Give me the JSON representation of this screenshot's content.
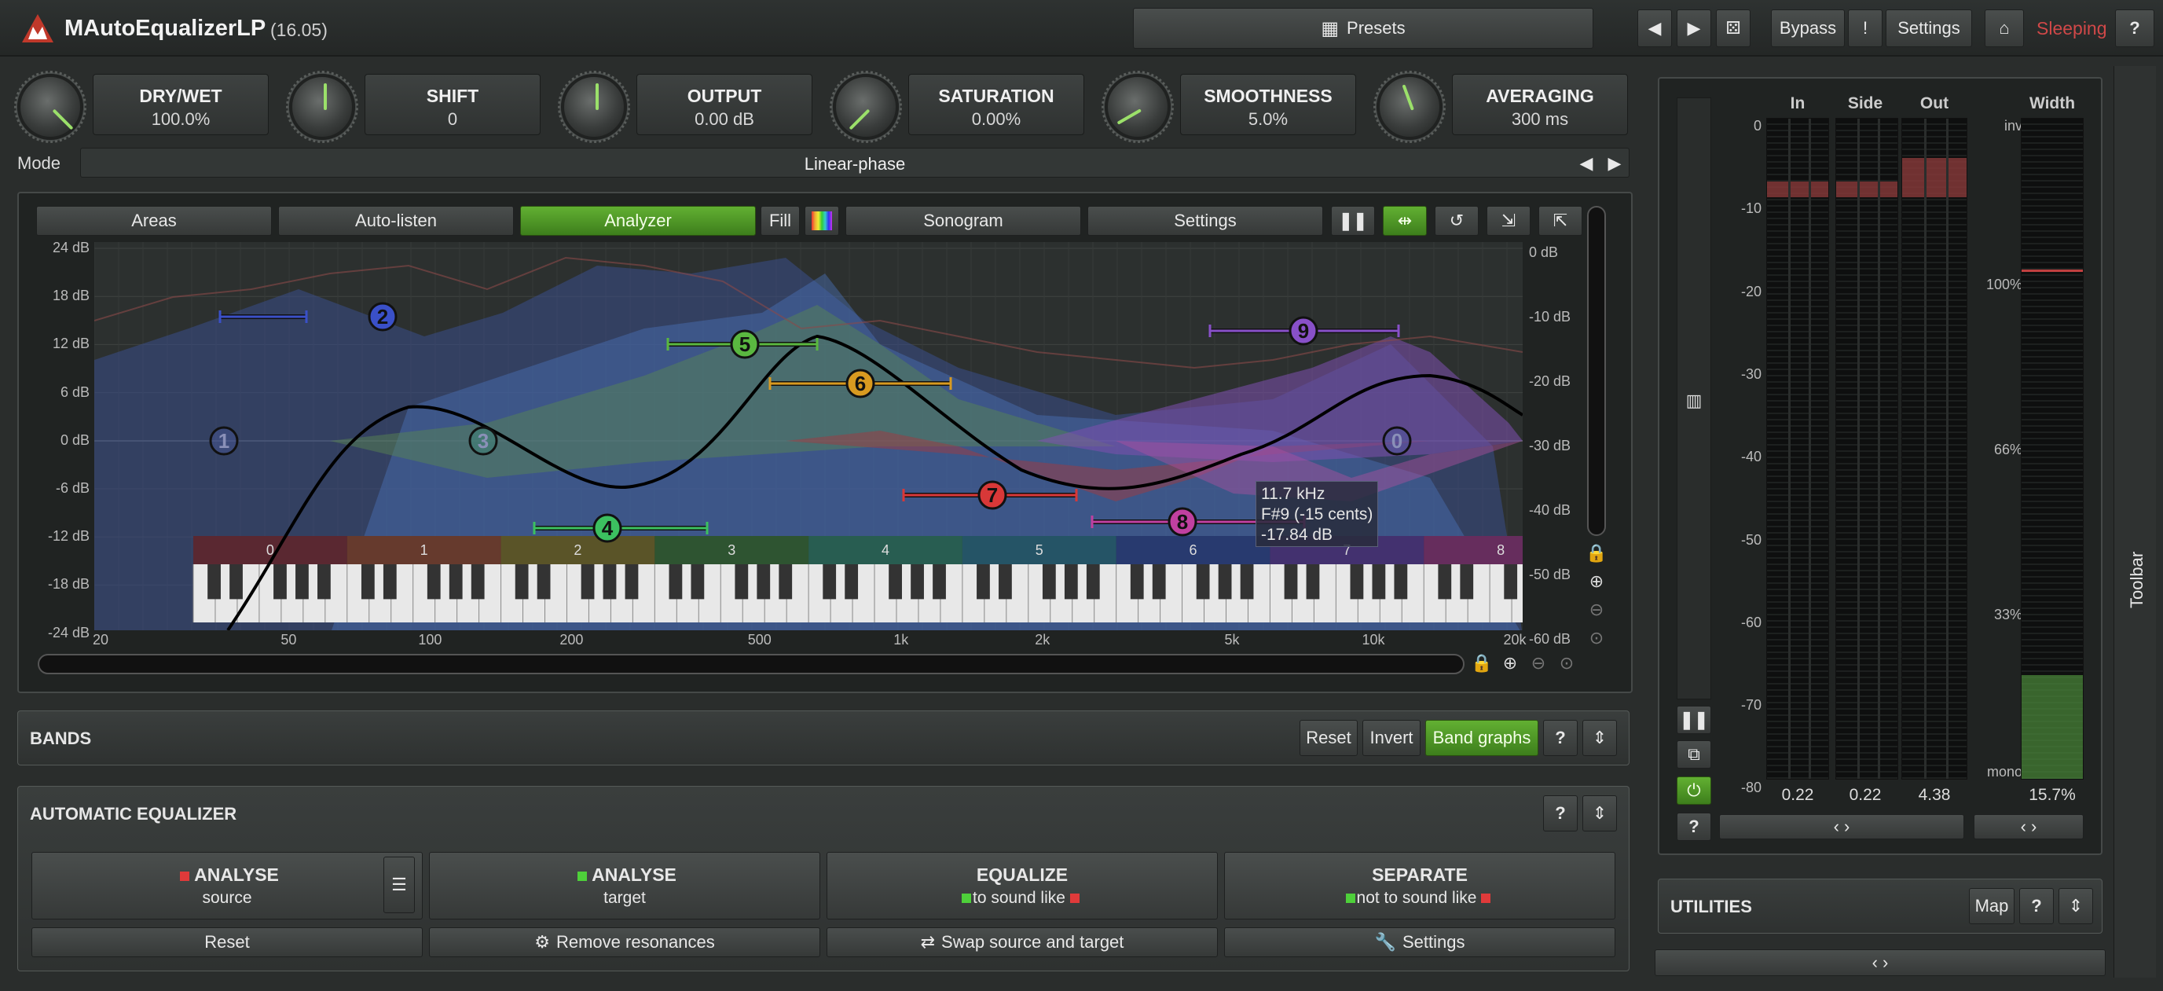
{
  "app": {
    "title": "MAutoEqualizerLP",
    "version": "(16.05)"
  },
  "topbar": {
    "presets": "Presets",
    "bypass": "Bypass",
    "settings": "Settings",
    "status": "Sleeping"
  },
  "params": [
    {
      "name": "DRY/WET",
      "value": "100.0%",
      "angle": 135
    },
    {
      "name": "SHIFT",
      "value": "0",
      "angle": 0
    },
    {
      "name": "OUTPUT",
      "value": "0.00 dB",
      "angle": 0
    },
    {
      "name": "SATURATION",
      "value": "0.00%",
      "angle": -135
    },
    {
      "name": "SMOOTHNESS",
      "value": "5.0%",
      "angle": -120
    },
    {
      "name": "AVERAGING",
      "value": "300 ms",
      "angle": -20
    }
  ],
  "mode": {
    "label": "Mode",
    "value": "Linear-phase"
  },
  "graph_toolbar": {
    "areas": "Areas",
    "autolisten": "Auto-listen",
    "analyzer": "Analyzer",
    "fill": "Fill",
    "sonogram": "Sonogram",
    "settings": "Settings"
  },
  "db_left": [
    "24 dB",
    "18 dB",
    "12 dB",
    "6 dB",
    "0 dB",
    "-6 dB",
    "-12 dB",
    "-18 dB",
    "-24 dB"
  ],
  "db_right": [
    "0 dB",
    "-10 dB",
    "-20 dB",
    "-30 dB",
    "-40 dB",
    "-50 dB",
    "-60 dB"
  ],
  "freq_labels": [
    "20",
    "50",
    "100",
    "200",
    "500",
    "1k",
    "2k",
    "5k",
    "10k",
    "20k"
  ],
  "octave_labels": [
    "0",
    "1",
    "2",
    "3",
    "4",
    "5",
    "6",
    "7",
    "8"
  ],
  "bands": [
    {
      "label": "1",
      "color": "#4a5aa0"
    },
    {
      "label": "2",
      "color": "#3a50c8"
    },
    {
      "label": "3",
      "color": "#3a8878"
    },
    {
      "label": "4",
      "color": "#3cc060"
    },
    {
      "label": "5",
      "color": "#5ab840"
    },
    {
      "label": "6",
      "color": "#d89a20"
    },
    {
      "label": "7",
      "color": "#d83838"
    },
    {
      "label": "8",
      "color": "#c040a0"
    },
    {
      "label": "9",
      "color": "#8850c8"
    },
    {
      "label": "0",
      "color": "#4a5aa0"
    }
  ],
  "tooltip": {
    "freq": "11.7 kHz",
    "note": "F#9 (-15 cents)",
    "gain": "-17.84 dB"
  },
  "bands_panel": {
    "title": "BANDS",
    "reset": "Reset",
    "invert": "Invert",
    "band_graphs": "Band graphs"
  },
  "auto_eq": {
    "title": "AUTOMATIC EQUALIZER",
    "analyse_source": {
      "title": "ANALYSE",
      "sub": "source"
    },
    "analyse_target": {
      "title": "ANALYSE",
      "sub": "target"
    },
    "equalize": {
      "title": "EQUALIZE",
      "sub": "to sound like"
    },
    "separate": {
      "title": "SEPARATE",
      "sub": "not to sound like"
    },
    "reset": "Reset",
    "remove_resonances": "Remove resonances",
    "swap": "Swap source and target",
    "settings": "Settings"
  },
  "meters": {
    "headers": [
      "In",
      "Side",
      "Out",
      "Width"
    ],
    "db_scale": [
      "0",
      "-10",
      "-20",
      "-30",
      "-40",
      "-50",
      "-60",
      "-70",
      "-80"
    ],
    "width_scale": [
      "inv",
      "100%",
      "66%",
      "33%",
      "mono"
    ],
    "values": [
      "0.22",
      "0.22",
      "4.38",
      "15.7%"
    ],
    "width_fill": 0.157
  },
  "utilities": {
    "title": "UTILITIES",
    "map": "Map"
  },
  "side": {
    "toolbar": "Toolbar"
  },
  "nav": {
    "lr": "‹ ›"
  },
  "colors": {
    "accent_green": "#5aae2c",
    "status_red": "#d84040",
    "bg": "#2a2d2c"
  }
}
